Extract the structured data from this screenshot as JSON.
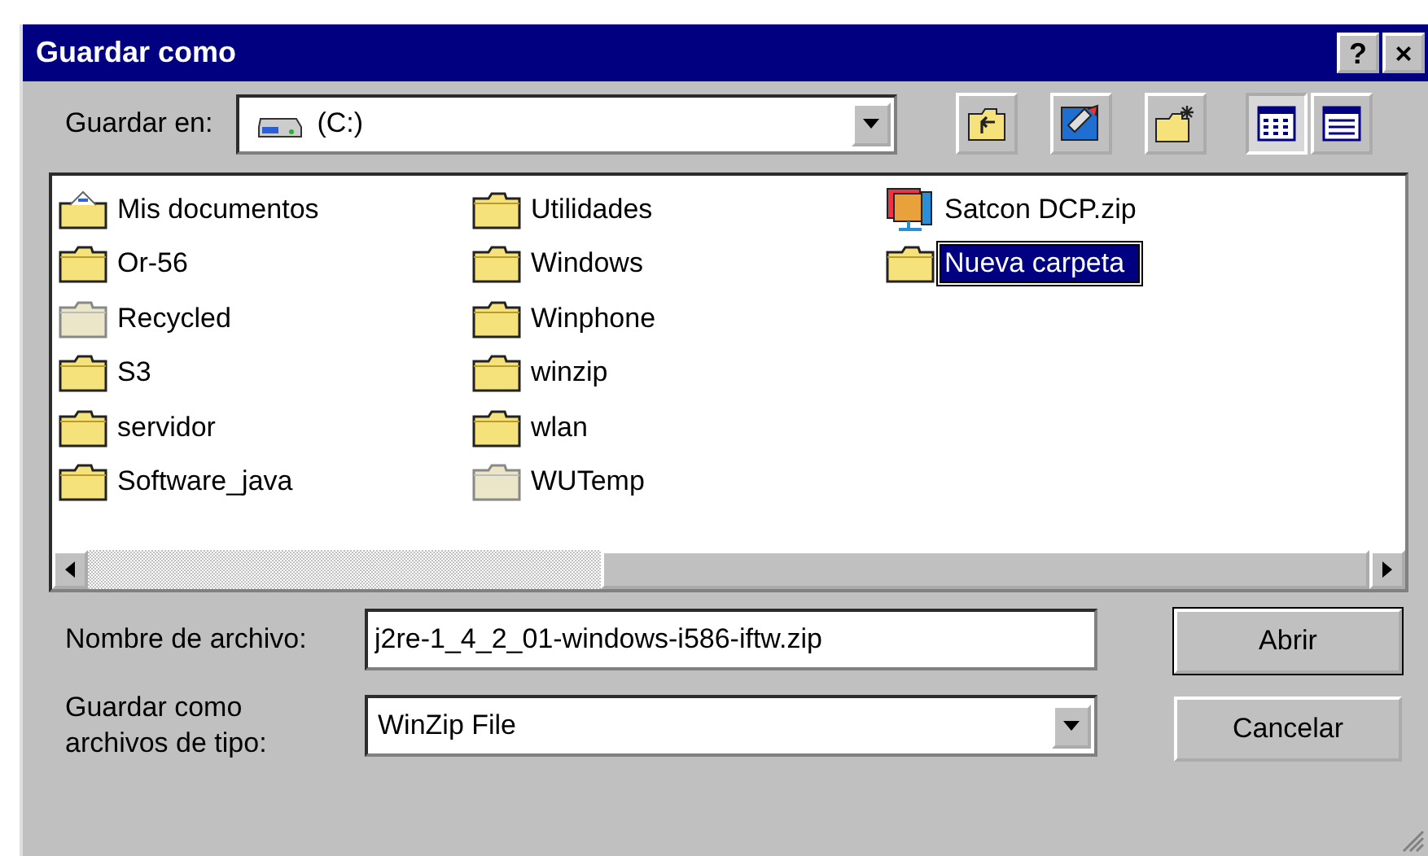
{
  "window": {
    "title": "Guardar como",
    "title_buttons": [
      "?",
      "×"
    ]
  },
  "save_in": {
    "label": "Guardar en:",
    "value": "(C:)"
  },
  "toolbar": [
    {
      "kind": "up-folder",
      "selected": false
    },
    {
      "kind": "desktop",
      "selected": false
    },
    {
      "kind": "new-folder",
      "selected": false
    },
    {
      "kind": "list-view",
      "selected": true
    },
    {
      "kind": "details-view",
      "selected": false
    }
  ],
  "files": [
    {
      "name": "Mis documentos",
      "kind": "special-folder",
      "editing": false
    },
    {
      "name": "Or-56",
      "kind": "folder",
      "editing": false
    },
    {
      "name": "Recycled",
      "kind": "pale-folder",
      "editing": false
    },
    {
      "name": "S3",
      "kind": "folder",
      "editing": false
    },
    {
      "name": "servidor",
      "kind": "folder",
      "editing": false
    },
    {
      "name": "Software_java",
      "kind": "folder",
      "editing": false
    },
    {
      "name": "Utilidades",
      "kind": "folder",
      "editing": false
    },
    {
      "name": "Windows",
      "kind": "folder",
      "editing": false
    },
    {
      "name": "Winphone",
      "kind": "folder",
      "editing": false
    },
    {
      "name": "winzip",
      "kind": "folder",
      "editing": false
    },
    {
      "name": "wlan",
      "kind": "folder",
      "editing": false
    },
    {
      "name": "WUTemp",
      "kind": "pale-folder",
      "editing": false
    },
    {
      "name": "Satcon DCP.zip",
      "kind": "zip",
      "editing": false
    },
    {
      "name": "Nueva carpeta",
      "kind": "folder",
      "editing": true
    }
  ],
  "file_name": {
    "label": "Nombre de archivo:",
    "value": "j2re-1_4_2_01-windows-i586-iftw.zip"
  },
  "file_type": {
    "label_lines": [
      "Guardar como",
      "archivos de tipo:"
    ],
    "value": "WinZip File"
  },
  "buttons": [
    {
      "label": "Abrir",
      "default": true
    },
    {
      "label": "Cancelar",
      "default": false
    }
  ]
}
